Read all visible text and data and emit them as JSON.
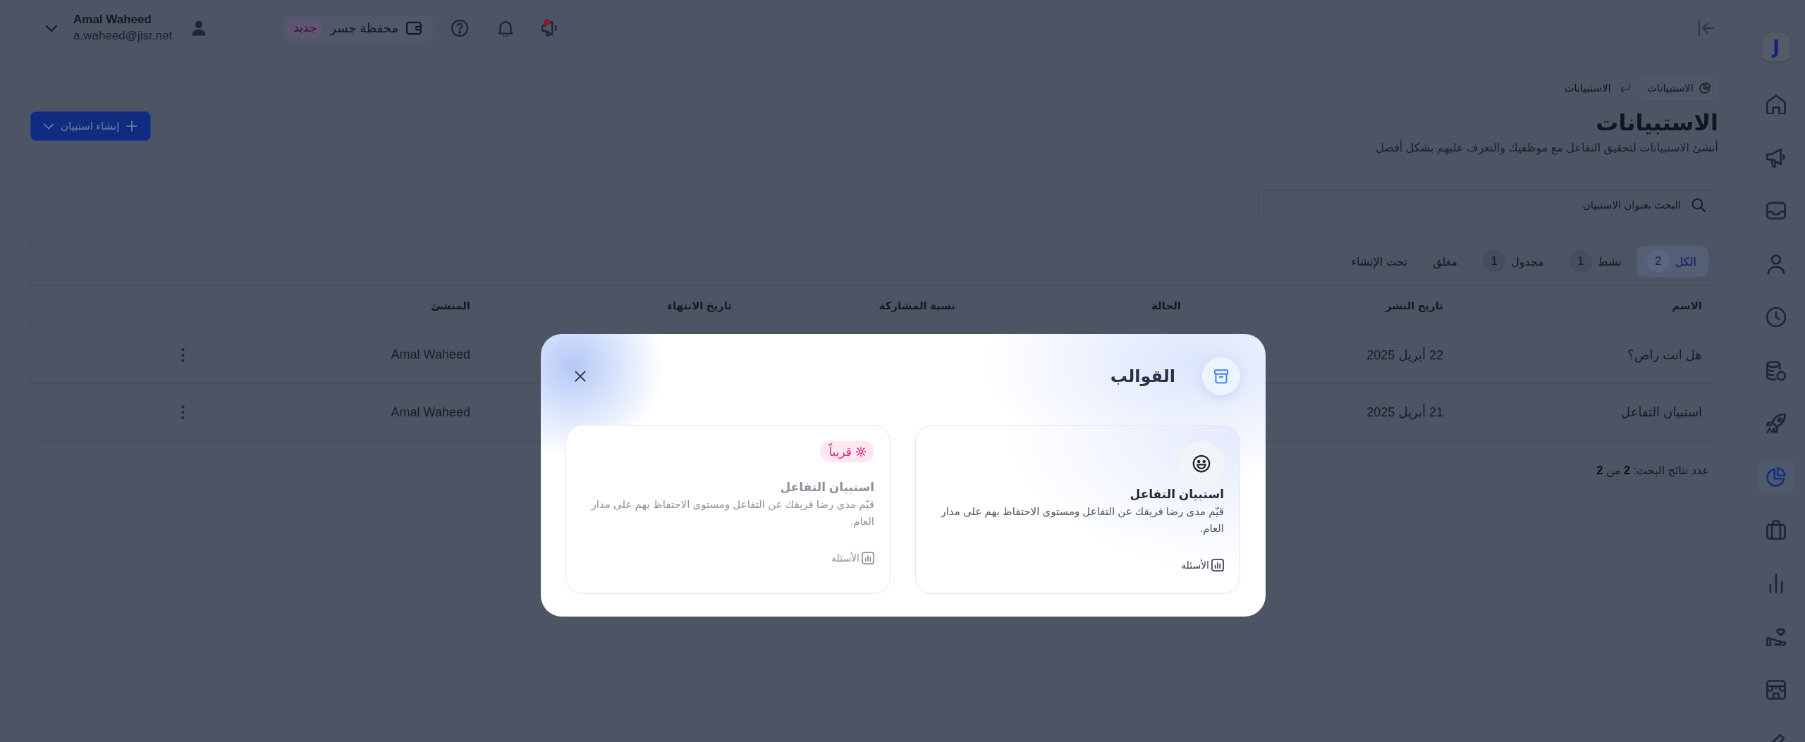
{
  "sidebar": {
    "logo": "J",
    "items": [
      {
        "selected": false
      },
      {
        "selected": false
      },
      {
        "selected": false
      },
      {
        "selected": false
      },
      {
        "selected": false
      },
      {
        "selected": false
      },
      {
        "selected": false
      },
      {
        "selected": true
      },
      {
        "selected": false
      },
      {
        "selected": false
      },
      {
        "selected": false
      },
      {
        "selected": false
      },
      {
        "selected": false
      }
    ]
  },
  "top_bar": {
    "user": {
      "name": "Amal Waheed",
      "email": "a.waheed@jisr.net"
    },
    "wallet": {
      "label": "محفظة جسر",
      "badge": "جديد"
    },
    "announcements": {
      "unread": true
    }
  },
  "header": {
    "breadcrumb": [
      {
        "kind": "section",
        "label": "الاستبيانات"
      },
      {
        "kind": "page",
        "label": "الاستبيانات"
      }
    ],
    "title": "الاستبيانات",
    "subtitle": "أنشئ الاستبيانات لتحقيق التفاعل مع موظفيك والتعرف عليهم بشكل أفضل",
    "create_button": "إنشاء استبيان"
  },
  "search": {
    "placeholder": "البحث بعنوان الاستبيان"
  },
  "table": {
    "tabs": [
      {
        "label": "الكل",
        "count": "2",
        "selected": true
      },
      {
        "label": "نشط",
        "count": "1",
        "selected": false
      },
      {
        "label": "مجدول",
        "count": "1",
        "selected": false
      },
      {
        "label": "مغلق",
        "selected": false
      },
      {
        "label": "تحت الإنشاء",
        "selected": false
      }
    ],
    "columns": [
      "الاسم",
      "تاريخ النشر",
      "الحالة",
      "نسبة المشاركة",
      "تاريخ الانتهاء",
      "المنشئ"
    ],
    "rows": [
      {
        "name": "هل انت راض؟",
        "published": "22 أبريل 2025",
        "creator": "Amal Waheed"
      },
      {
        "name": "استبيان التفاعل",
        "published": "21 أبريل 2025",
        "creator": "Amal Waheed"
      }
    ]
  },
  "results_count": "عدد نتائج البحث: **2** من **2**",
  "modal": {
    "title": "القوالب",
    "templates": [
      {
        "title": "استبيان التفاعل",
        "description": "قيّم مدى رضا فريقك عن التفاعل ومستوى الاحتفاظ بهم على مدار العام.",
        "footer": "الأسئلة",
        "locked": false
      },
      {
        "badge": "قريباً",
        "title": "استبيان التفاعل",
        "description": "قيّم مدى رضا فريقك عن التفاعل ومستوى الاحتفاظ بهم على مدار العام.",
        "footer": "الأسئلة",
        "locked": true
      }
    ]
  }
}
